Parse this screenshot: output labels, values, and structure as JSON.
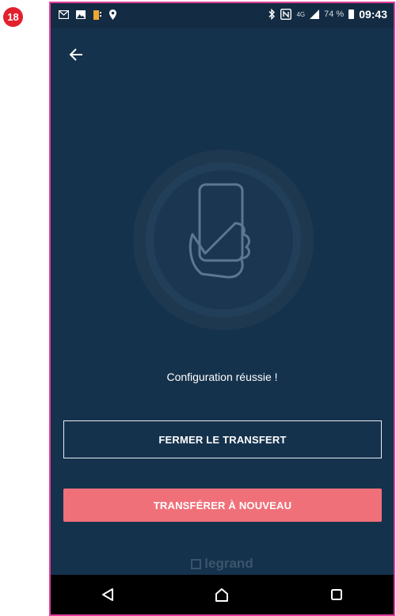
{
  "step_badge": "18",
  "status_bar": {
    "network_label": "4G",
    "battery": "74 %",
    "time": "09:43"
  },
  "screen": {
    "message": "Configuration réussie !",
    "close_button_label": "FERMER LE TRANSFERT",
    "retry_button_label": "TRANSFÉRER À NOUVEAU",
    "brand": "legrand"
  },
  "colors": {
    "background": "#15324d",
    "primary_button": "#f07079",
    "frame": "#e53d9c",
    "badge": "#e2202e"
  },
  "icons": {
    "back": "arrow-left-icon",
    "hero": "phone-in-hand-icon",
    "nav": [
      "back-triangle-icon",
      "home-icon",
      "recents-icon"
    ]
  }
}
